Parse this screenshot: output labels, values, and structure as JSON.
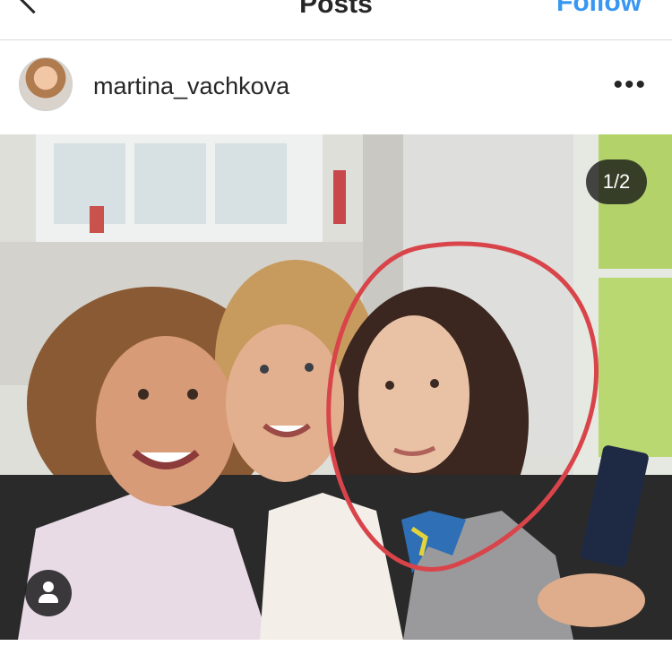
{
  "topbar": {
    "back_icon": "chevron-left-icon",
    "title": "Posts",
    "follow_label": "Follow"
  },
  "post": {
    "username": "martina_vachkova",
    "more_icon": "more-horizontal-icon",
    "more_glyph": "•••",
    "media_counter": "1/2",
    "tag_icon": "user-tag-icon"
  },
  "colors": {
    "link_blue": "#3897f0",
    "text": "#262626",
    "divider": "#dbdbdb",
    "annotation_red": "#d9444a"
  }
}
